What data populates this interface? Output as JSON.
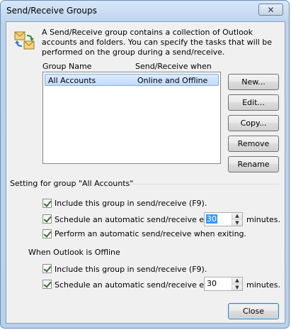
{
  "window": {
    "title": "Send/Receive Groups",
    "close_glyph": "✕"
  },
  "description": "A Send/Receive group contains a collection of Outlook accounts and folders. You can specify the tasks that will be performed on the group during a send/receive.",
  "icon": "send-receive-groups-icon",
  "list": {
    "columns": [
      "Group Name",
      "Send/Receive when"
    ],
    "rows": [
      {
        "name": "All Accounts",
        "when": "Online and Offline",
        "selected": true
      }
    ]
  },
  "buttons": {
    "new": "New...",
    "edit": "Edit...",
    "copy": "Copy...",
    "remove": "Remove",
    "rename": "Rename",
    "close": "Close"
  },
  "settings": {
    "heading": "Setting for group \"All Accounts\"",
    "online": {
      "include_label": "Include this group in send/receive (F9).",
      "include_checked": true,
      "schedule_label": "Schedule an automatic send/receive every",
      "schedule_checked": true,
      "minutes_value": "30",
      "minutes_unit": "minutes.",
      "exit_label": "Perform an automatic send/receive when exiting.",
      "exit_checked": true
    },
    "offline": {
      "heading": "When Outlook is Offline",
      "include_label": "Include this group in send/receive (F9).",
      "include_checked": true,
      "schedule_label": "Schedule an automatic send/receive every",
      "schedule_checked": true,
      "minutes_value": "30",
      "minutes_unit": "minutes."
    }
  },
  "colors": {
    "accent": "#3399ff",
    "selection_row": "#c1dbfc",
    "frame": "#b9d1ec"
  }
}
